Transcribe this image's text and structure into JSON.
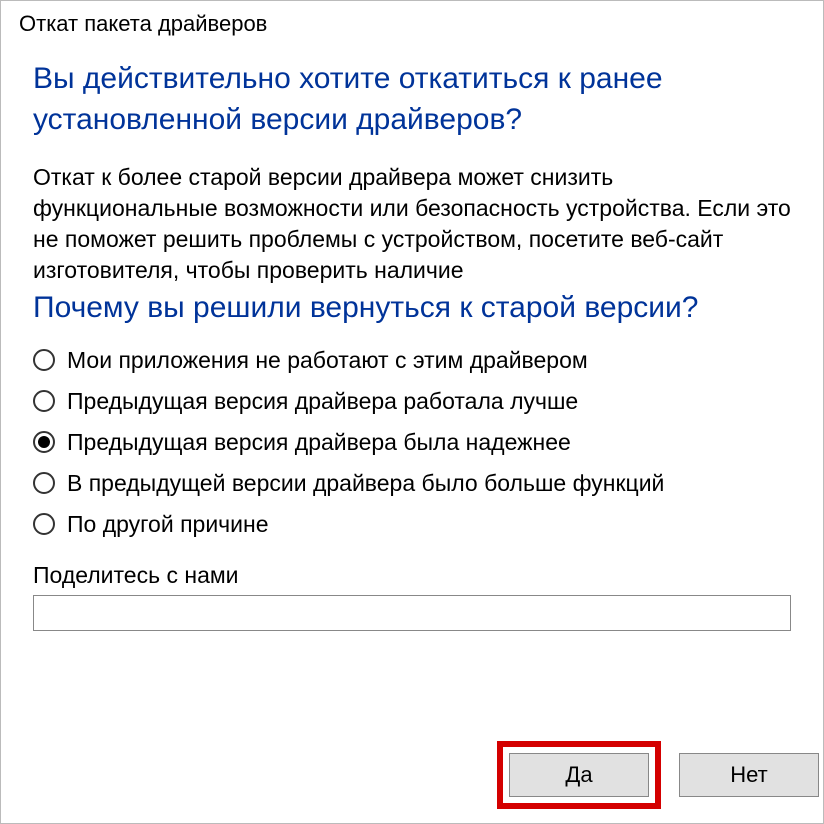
{
  "dialog": {
    "title": "Откат пакета драйверов",
    "heading": "Вы действительно хотите откатиться к ранее установленной версии драйверов?",
    "description": "Откат к более старой версии драйвера может снизить функциональные возможности или безопасность устройства. Если это не поможет решить проблемы с устройством, посетите веб-сайт изготовителя, чтобы проверить наличие",
    "subheading": "Почему вы решили вернуться к старой версии?",
    "reasons": [
      {
        "label": "Мои приложения не работают с этим драйвером",
        "selected": false
      },
      {
        "label": "Предыдущая версия драйвера работала лучше",
        "selected": false
      },
      {
        "label": "Предыдущая версия драйвера была надежнее",
        "selected": true
      },
      {
        "label": "В предыдущей версии драйвера было больше функций",
        "selected": false
      },
      {
        "label": "По другой причине",
        "selected": false
      }
    ],
    "share_label": "Поделитесь с нами",
    "share_value": "",
    "yes_label": "Да",
    "no_label": "Нет"
  }
}
